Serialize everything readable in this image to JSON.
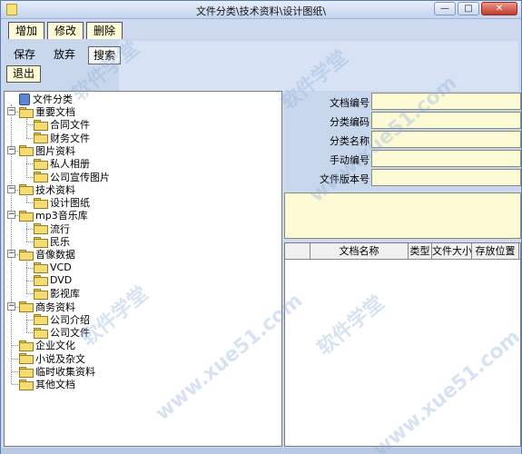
{
  "window": {
    "title": "文件分类\\技术资料\\设计图纸\\",
    "minimize": "—",
    "maximize": "□",
    "close": "✕"
  },
  "toolbar": {
    "add": "增加",
    "edit": "修改",
    "delete": "删除",
    "save": "保存",
    "discard": "放弃",
    "search": "搜索",
    "exit": "退出"
  },
  "tree": {
    "root": "文件分类",
    "items": [
      {
        "label": "重要文档",
        "level": 1,
        "expander": "−"
      },
      {
        "label": "合同文件",
        "level": 2
      },
      {
        "label": "财务文件",
        "level": 2
      },
      {
        "label": "图片资料",
        "level": 1,
        "expander": "−"
      },
      {
        "label": "私人相册",
        "level": 2
      },
      {
        "label": "公司宣传图片",
        "level": 2
      },
      {
        "label": "技术资料",
        "level": 1,
        "expander": "−"
      },
      {
        "label": "设计图纸",
        "level": 2
      },
      {
        "label": "mp3音乐库",
        "level": 1,
        "expander": "−"
      },
      {
        "label": "流行",
        "level": 2
      },
      {
        "label": "民乐",
        "level": 2
      },
      {
        "label": "音像数据",
        "level": 1,
        "expander": "−"
      },
      {
        "label": "VCD",
        "level": 2
      },
      {
        "label": "DVD",
        "level": 2
      },
      {
        "label": "影视库",
        "level": 2
      },
      {
        "label": "商务资料",
        "level": 1,
        "expander": "−"
      },
      {
        "label": "公司介绍",
        "level": 2
      },
      {
        "label": "公司文件",
        "level": 2
      },
      {
        "label": "企业文化",
        "level": 1
      },
      {
        "label": "小说及杂文",
        "level": 1
      },
      {
        "label": "临时收集资料",
        "level": 1
      },
      {
        "label": "其他文档",
        "level": 1
      }
    ]
  },
  "form": {
    "fields": [
      {
        "label": "文档编号",
        "value": ""
      },
      {
        "label": "分类编码",
        "value": ""
      },
      {
        "label": "分类名称",
        "value": ""
      },
      {
        "label": "手动编号",
        "value": ""
      },
      {
        "label": "文件版本号",
        "value": ""
      }
    ],
    "memo": ""
  },
  "grid": {
    "columns": [
      "",
      "文档名称",
      "类型",
      "文件大小",
      "存放位置"
    ]
  },
  "watermark": {
    "text1": "软件学堂",
    "text2": "www.xue51.com"
  },
  "colors": {
    "accent": "#ccd9ee",
    "input_bg": "#fdfbd6",
    "folder": "#f3dc74"
  }
}
